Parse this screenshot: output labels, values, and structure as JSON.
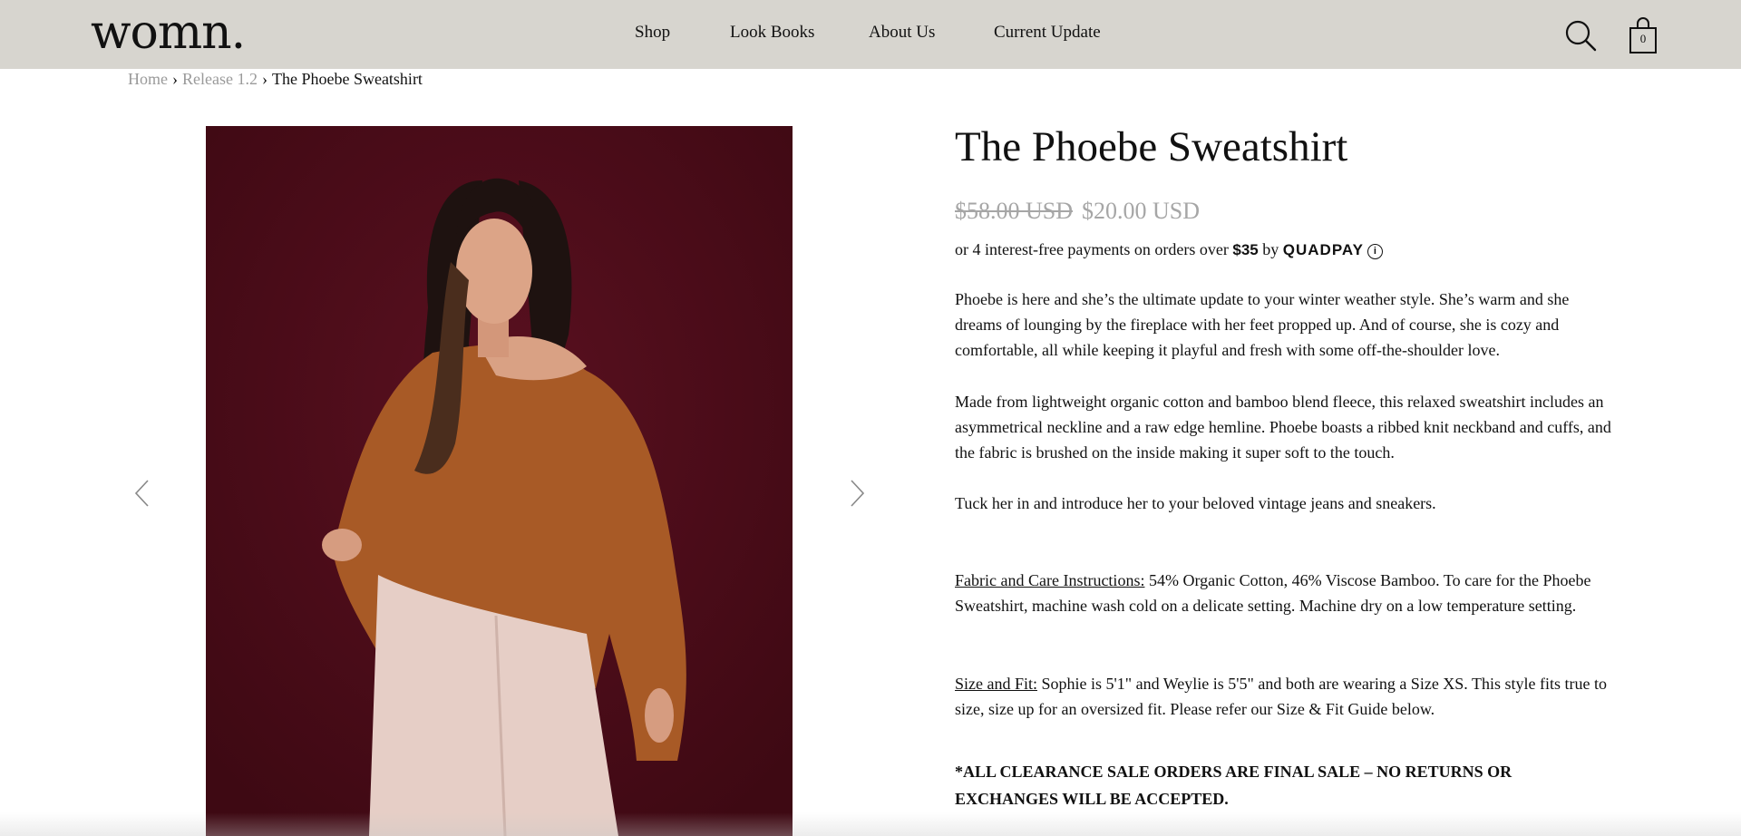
{
  "header": {
    "logo": "womn.",
    "nav": [
      "Shop",
      "Look Books",
      "About Us",
      "Current Update"
    ],
    "cart_count": "0"
  },
  "breadcrumb": {
    "home": "Home",
    "collection": "Release 1.2",
    "current": "The Phoebe Sweatshirt",
    "separator": "›"
  },
  "product": {
    "title": "The Phoebe Sweatshirt",
    "price_original": "$58.00 USD",
    "price_sale": "$20.00 USD",
    "quadpay": {
      "text_before": "or 4 interest-free payments on orders over",
      "amount": "$35",
      "by": "by",
      "brand": "QUADPAY",
      "info_icon": "i"
    },
    "description": [
      "Phoebe is here and she’s the ultimate update to your winter weather style. She’s warm and she dreams of lounging by the fireplace with her feet propped up. And of course, she is cozy and comfortable, all while keeping it playful and fresh with some off-the-shoulder love.",
      "Made from lightweight organic cotton and bamboo blend fleece, this relaxed sweatshirt includes an asymmetrical neckline and a raw edge hemline. Phoebe boasts a ribbed knit neckband and cuffs, and the fabric is brushed on the inside making it super soft to the touch.",
      "Tuck her in and introduce her to your beloved vintage jeans and sneakers."
    ],
    "care": {
      "label": "Fabric and Care Instructions:",
      "text": " 54% Organic Cotton, 46% Viscose Bamboo. To care for the Phoebe Sweatshirt, machine wash cold on a delicate setting. Machine dry on a low temperature setting."
    },
    "fit": {
      "label": "Size and Fit:",
      "text": " Sophie is 5'1\" and Weylie is 5'5\" and both are wearing a Size XS. This style fits true to size, size up for an oversized fit. Please refer our Size & Fit Guide below."
    },
    "notice": "*ALL CLEARANCE SALE ORDERS ARE FINAL SALE – NO RETURNS OR EXCHANGES WILL BE ACCEPTED."
  },
  "icons": {
    "search": "search-icon",
    "cart": "shopping-bag-icon",
    "prev": "chevron-left-icon",
    "next": "chevron-right-icon"
  },
  "colors": {
    "header_bg": "#d7d5cf",
    "photo_bg": "#4e0d1a",
    "sweatshirt": "#a85a26",
    "muted_text": "#9a9a9a"
  }
}
